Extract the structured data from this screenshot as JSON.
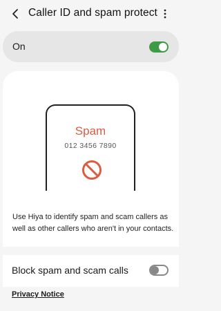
{
  "header": {
    "title": "Caller ID and spam protect"
  },
  "master_switch": {
    "label": "On",
    "state": "on",
    "accent_color": "#3e9a45"
  },
  "illustration": {
    "caller_label": "Spam",
    "caller_number": "012 3456 7890",
    "icon": "block-icon",
    "accent_color": "#dd5b3f"
  },
  "description": "Use Hiya to identify spam and scam callers as well as other callers who aren't in your contacts.",
  "block_setting": {
    "label": "Block spam and scam calls",
    "state": "off"
  },
  "privacy_link": "Privacy Notice"
}
